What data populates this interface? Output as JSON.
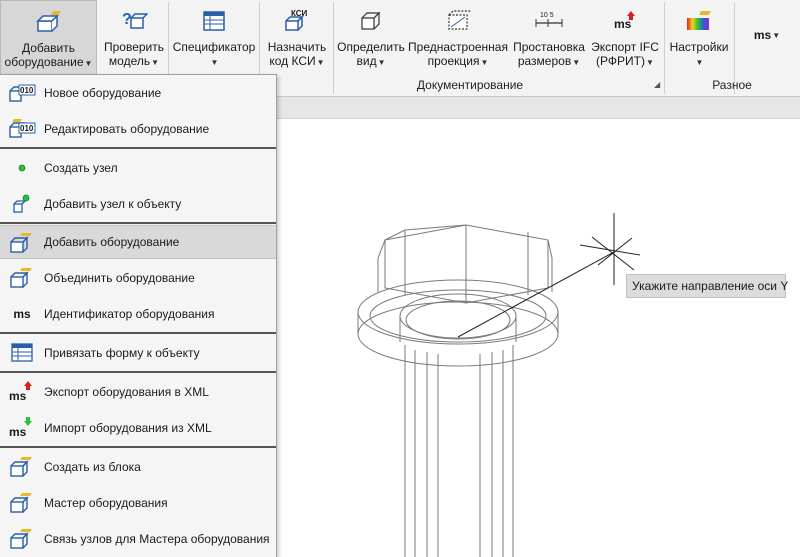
{
  "ribbon": {
    "buttons": [
      {
        "line1": "Добавить",
        "line2": "оборудование",
        "icon": "add-equipment-icon"
      },
      {
        "line1": "Проверить",
        "line2": "модель",
        "icon": "check-model-icon"
      },
      {
        "line1": "Спецификатор",
        "line2": "",
        "icon": "specifier-icon"
      },
      {
        "line1": "Назначить",
        "line2": "код КСИ",
        "icon": "ksi-code-icon",
        "icon_text": "КСИ"
      },
      {
        "line1": "Определить",
        "line2": "вид",
        "icon": "define-view-icon"
      },
      {
        "line1": "Преднастроенная",
        "line2": "проекция",
        "icon": "preset-projection-icon"
      },
      {
        "line1": "Простановка",
        "line2": "размеров",
        "icon": "dimensions-icon",
        "icon_text": "10 5"
      },
      {
        "line1": "Экспорт IFC",
        "line2": "(РФРИТ)",
        "icon": "export-ifc-icon",
        "icon_text": "ms"
      },
      {
        "line1": "Настройки",
        "line2": "",
        "icon": "settings-icon"
      },
      {
        "line1": "",
        "line2": "",
        "icon": "ms-icon",
        "icon_text": "ms"
      }
    ],
    "groups": {
      "documentation": "Документирование",
      "misc": "Разное"
    }
  },
  "menu": {
    "items": [
      {
        "label": "Новое оборудование",
        "icon": "new-equipment-icon",
        "icon_text": "010"
      },
      {
        "label": "Редактировать оборудование",
        "icon": "edit-equipment-icon",
        "icon_text": "010"
      },
      {
        "label": "Создать узел",
        "icon": "create-node-icon"
      },
      {
        "label": "Добавить узел к объекту",
        "icon": "add-node-icon"
      },
      {
        "label": "Добавить оборудование",
        "icon": "add-equipment-icon",
        "highlighted": true
      },
      {
        "label": "Объединить оборудование",
        "icon": "merge-equipment-icon"
      },
      {
        "label": "Идентификатор оборудования",
        "icon": "equipment-id-icon",
        "icon_text": "ms"
      },
      {
        "label": "Привязать форму к объекту",
        "icon": "bind-form-icon"
      },
      {
        "label": "Экспорт оборудования в XML",
        "icon": "export-xml-icon",
        "icon_text": "ms"
      },
      {
        "label": "Импорт оборудования из XML",
        "icon": "import-xml-icon",
        "icon_text": "ms"
      },
      {
        "label": "Создать из блока",
        "icon": "create-from-block-icon"
      },
      {
        "label": "Мастер оборудования",
        "icon": "equipment-wizard-icon"
      },
      {
        "label": "Связь узлов для Мастера оборудования",
        "icon": "link-nodes-icon"
      }
    ]
  },
  "canvas": {
    "tooltip": "Укажите направление оси Y"
  },
  "colors": {
    "ribbon_bg": "#f3f3f3",
    "menu_bg": "#f5f5f5",
    "highlight": "#d9d9d9",
    "icon_blue": "#2a5fa8",
    "icon_yellow": "#e8b730",
    "icon_green": "#2fbf3a",
    "icon_red": "#d42020"
  }
}
